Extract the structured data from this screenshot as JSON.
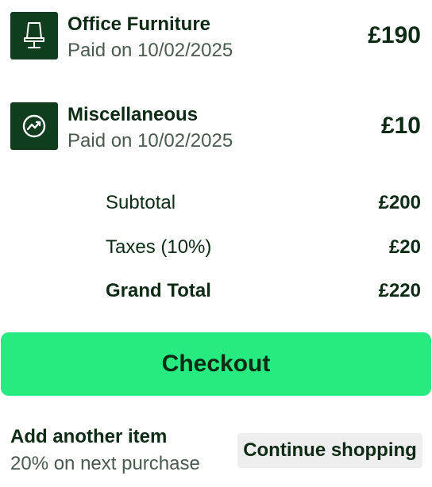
{
  "items": [
    {
      "icon": "chair-icon",
      "title": "Office Furniture",
      "subtitle": "Paid on 10/02/2025",
      "price": "£190"
    },
    {
      "icon": "trending-up-icon",
      "title": "Miscellaneous",
      "subtitle": "Paid on 10/02/2025",
      "price": "£10"
    }
  ],
  "summary": {
    "subtotal_label": "Subtotal",
    "subtotal_value": "£200",
    "taxes_label": "Taxes (10%)",
    "taxes_value": "£20",
    "grand_total_label": "Grand Total",
    "grand_total_value": "£220"
  },
  "checkout_label": "Checkout",
  "footer": {
    "title": "Add another item",
    "subtitle": "20% on next purchase",
    "continue_label": "Continue shopping"
  },
  "colors": {
    "primary_dark": "#0f3d1d",
    "accent_green": "#27ea80",
    "text_dark": "#0c2a14",
    "text_muted": "#4a5a4e",
    "secondary_button": "#eeeeee"
  }
}
